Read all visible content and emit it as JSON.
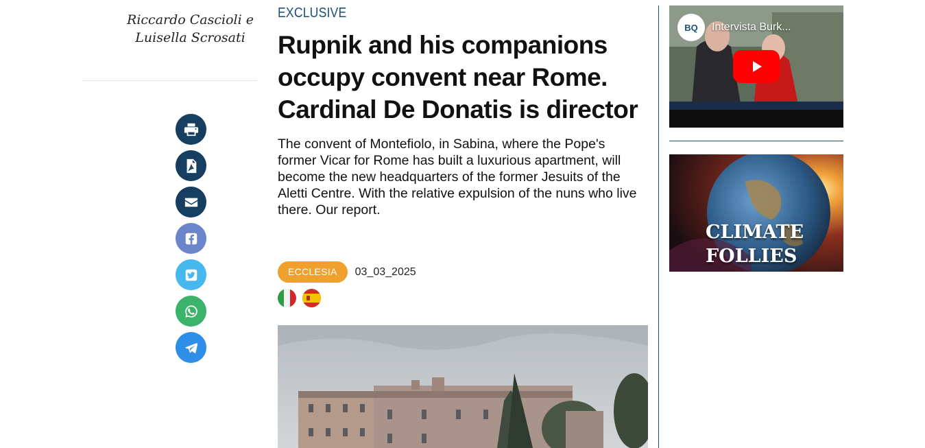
{
  "author": {
    "line1": "Riccardo Cascioli e",
    "line2": "Luisella Scrosati"
  },
  "share": {
    "icons": [
      "print-icon",
      "pdf-icon",
      "email-icon",
      "facebook-icon",
      "twitter-icon",
      "whatsapp-icon",
      "telegram-icon"
    ],
    "colors": {
      "dark": "#153e60",
      "facebook": "#6a85c9",
      "twitter": "#47b8ee",
      "whatsapp": "#3cb36b",
      "telegram": "#2f8ee8"
    }
  },
  "article": {
    "kicker": "EXCLUSIVE",
    "headline": "Rupnik and his companions occupy convent near Rome. Cardinal De Donatis is director",
    "summary": "The convent of Montefiolo, in Sabina, where the Pope's former Vicar for Rome has built a luxurious apartment, will become the new headquarters of the former Jesuits of the Aletti Centre. With the relative expulsion of the nuns who live there. Our report.",
    "category": "ECCLESIA",
    "date": "03_03_2025",
    "languages": [
      "italian-flag-icon",
      "spanish-flag-icon"
    ]
  },
  "sidebar": {
    "video": {
      "channel_logo": "BQ",
      "title": "Intervista Burk..."
    },
    "banner": {
      "line1": "CLIMATE",
      "line2": "FOLLIES"
    }
  },
  "colors": {
    "kicker": "#1b4f7a",
    "category": "#f0a02c",
    "divider": "#1e4d73"
  }
}
